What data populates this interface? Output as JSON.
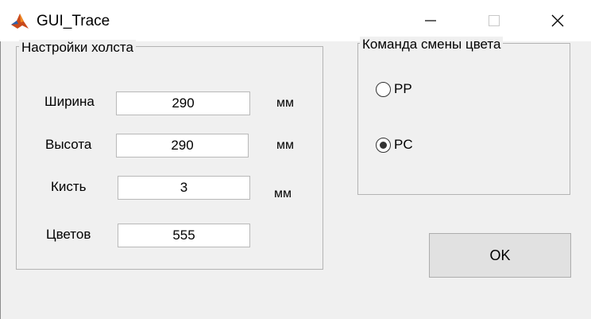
{
  "window": {
    "title": "GUI_Trace",
    "app_icon": "matlab-icon",
    "controls": [
      "minimize-icon",
      "maximize-icon",
      "close-icon"
    ]
  },
  "canvas_settings": {
    "title": "Настройки холста",
    "fields": [
      {
        "label": "Ширина",
        "value": "290",
        "unit": "мм"
      },
      {
        "label": "Высота",
        "value": "290",
        "unit": "мм"
      },
      {
        "label": "Кисть",
        "value": "3",
        "unit": "мм"
      },
      {
        "label": "Цветов",
        "value": "555",
        "unit": ""
      }
    ]
  },
  "color_command": {
    "title": "Команда смены цвета",
    "options": [
      {
        "label": "PP",
        "selected": false
      },
      {
        "label": "PC",
        "selected": true
      }
    ]
  },
  "ok_button": {
    "label": "OK"
  }
}
